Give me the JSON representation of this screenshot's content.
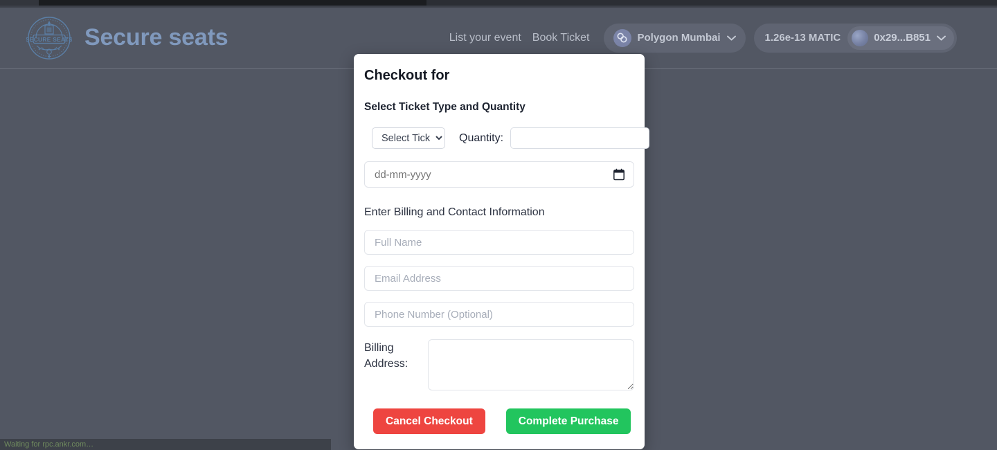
{
  "brand": {
    "name": "Secure seats",
    "logo_text": "SECURE SEATS",
    "logo_color": "#5b7fa6",
    "name_color": "#8099bd"
  },
  "header": {
    "nav_links": [
      {
        "label": "List your event"
      },
      {
        "label": "Book Ticket"
      }
    ],
    "network_chip": {
      "label": "Polygon Mumbai",
      "icon": "polygon-icon",
      "chevron": "chevron-down-icon"
    },
    "wallet": {
      "balance": "1.26e-13 MATIC",
      "address": "0x29...B851",
      "avatar": "wallet-avatar",
      "chevron": "chevron-down-icon"
    }
  },
  "modal": {
    "title": "Checkout for",
    "ticket_section_label": "Select Ticket Type and Quantity",
    "ticket_select": {
      "selected": "Select Tick",
      "options": [
        "Select Tick"
      ]
    },
    "quantity_label": "Quantity:",
    "quantity_value": "",
    "quantity_placeholder": "",
    "date_placeholder": "dd-mm-yyyy",
    "date_value": "",
    "date_icon": "calendar-icon",
    "billing_section_label": "Enter Billing and Contact Information",
    "fields": [
      {
        "name": "full-name",
        "placeholder": "Full Name",
        "value": ""
      },
      {
        "name": "email",
        "placeholder": "Email Address",
        "value": ""
      },
      {
        "name": "phone",
        "placeholder": "Phone Number (Optional)",
        "value": ""
      }
    ],
    "address_label": "Billing Address:",
    "address_value": "",
    "buttons": {
      "cancel": {
        "label": "Cancel Checkout",
        "color": "#ee4540"
      },
      "complete": {
        "label": "Complete Purchase",
        "color": "#22c55e"
      }
    }
  },
  "status_bar": {
    "text": "Waiting for rpc.ankr.com…"
  },
  "colors": {
    "page_background": "#525763",
    "modal_background": "#ffffff",
    "chip_background": "#5f6472"
  }
}
